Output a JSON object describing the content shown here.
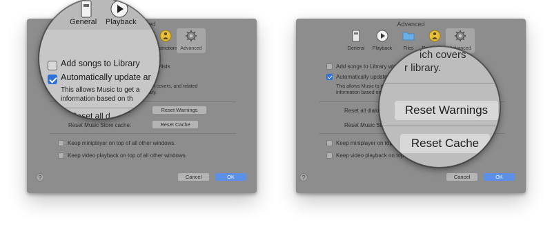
{
  "window": {
    "title": "Advanced"
  },
  "toolbar": {
    "general": "General",
    "playback": "Playback",
    "files": "Files",
    "restrictions": "Restrictions",
    "advanced": "Advanced"
  },
  "options": {
    "add_songs": "Add songs to Library when adding to playlists",
    "auto_update": "Automatically update artwork",
    "auto_update_desc_1": "This allows Music to get artist images, album covers, and related",
    "auto_update_desc_2": "information based on the items in your library.",
    "reset_dialog_label": "Reset all dialog warnings:",
    "reset_warnings_button": "Reset Warnings",
    "reset_cache_label": "Reset Music Store cache:",
    "reset_cache_button": "Reset Cache",
    "miniplayer": "Keep miniplayer on top of all other windows.",
    "video_playback": "Keep video playback on top of all other windows."
  },
  "footer": {
    "help": "?",
    "cancel": "Cancel",
    "ok": "OK"
  },
  "state": {
    "add_songs_checked": false,
    "auto_update_checked": true,
    "miniplayer_checked": false,
    "video_checked": false
  },
  "magnifier_left": {
    "general": "General",
    "playback": "Playback",
    "add_songs": "Add songs to Library",
    "auto_update": "Automatically update ar",
    "desc_1": "This allows Music to get a",
    "desc_2": "information based on th",
    "reset_all": "Reset all d"
  },
  "magnifier_right": {
    "top_text_1": "ich covers",
    "top_text_2": "r library.",
    "reset_warnings": "Reset Warnings",
    "reset_cache": "Reset Cache"
  },
  "colors": {
    "accent_blue": "#2d6fd6",
    "window_bg": "#8d8d8d",
    "restrictions_yellow": "#e9bd3c"
  }
}
